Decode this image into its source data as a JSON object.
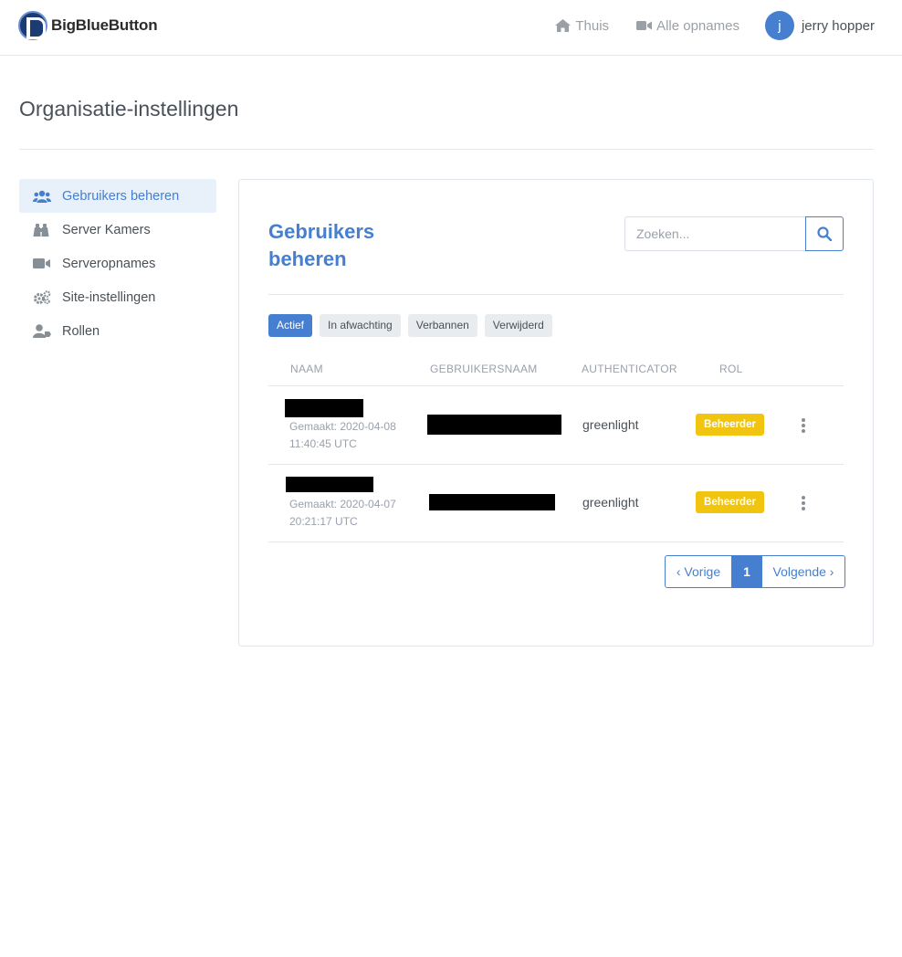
{
  "header": {
    "brand": "BigBlueButton",
    "nav_home": "Thuis",
    "nav_recordings": "Alle opnames",
    "avatar_initial": "j",
    "username": "jerry hopper"
  },
  "page": {
    "title": "Organisatie-instellingen"
  },
  "sidebar": {
    "items": [
      {
        "label": "Gebruikers beheren",
        "icon": "users-icon",
        "active": true
      },
      {
        "label": "Server Kamers",
        "icon": "binoculars-icon"
      },
      {
        "label": "Serveropnames",
        "icon": "video-icon"
      },
      {
        "label": "Site-instellingen",
        "icon": "gears-icon"
      },
      {
        "label": "Rollen",
        "icon": "user-tag-icon"
      }
    ]
  },
  "card": {
    "title": "Gebruikers beheren",
    "search_placeholder": "Zoeken...",
    "filters": [
      "Actief",
      "In afwachting",
      "Verbannen",
      "Verwijderd"
    ],
    "columns": [
      "NAAM",
      "GEBRUIKERSNAAM",
      "AUTHENTICATOR",
      "ROL"
    ],
    "rows": [
      {
        "created_line1": "Gemaakt: 2020-04-08",
        "created_line2": "11:40:45 UTC",
        "authenticator": "greenlight",
        "role": "Beheerder"
      },
      {
        "created_line1": "Gemaakt: 2020-04-07",
        "created_line2": "20:21:17 UTC",
        "authenticator": "greenlight",
        "role": "Beheerder"
      }
    ],
    "pagination": {
      "prev": "‹ Vorige",
      "current": "1",
      "next": "Volgende ›"
    }
  },
  "colors": {
    "accent": "#467fcf",
    "role_badge": "#f1c40f"
  }
}
